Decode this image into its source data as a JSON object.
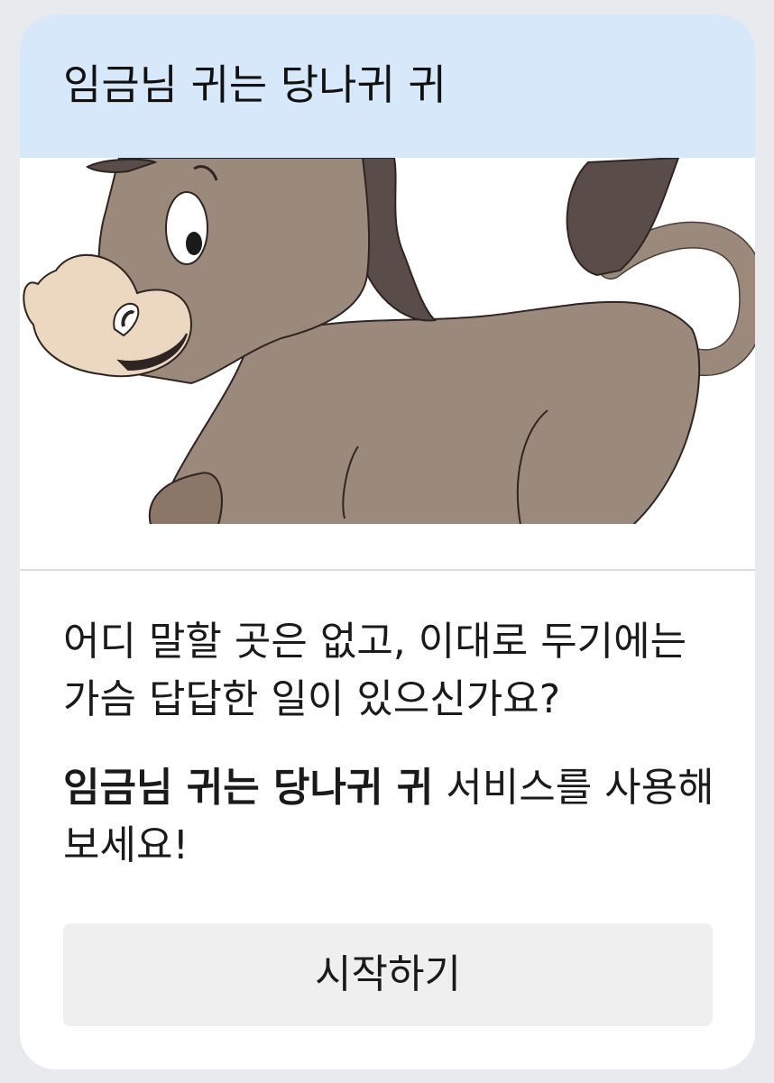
{
  "header": {
    "title": "임금님 귀는 당나귀 귀"
  },
  "illustration": {
    "subject": "donkey-illustration"
  },
  "intro": {
    "text": "어디 말할 곳은 없고, 이대로 두기에는 가슴 답답한 일이 있으신가요?"
  },
  "promo": {
    "service_name": "임금님 귀는 당나귀 귀",
    "suffix": " 서비스를 사용해보세요!"
  },
  "actions": {
    "start_label": "시작하기"
  },
  "colors": {
    "page_background": "#e9eaee",
    "header_background": "#d7e8fa",
    "button_background": "#efeff0",
    "donkey_body": "#9b8a7b",
    "donkey_mane": "#5a4c49",
    "donkey_muzzle": "#ecd7c0"
  }
}
